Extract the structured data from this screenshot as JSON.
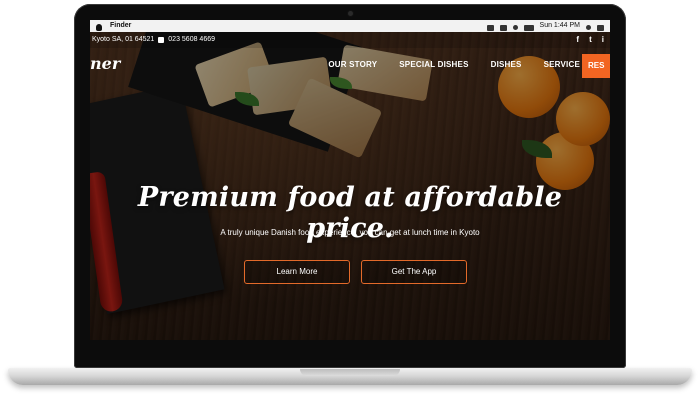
{
  "menubar": {
    "app": "Finder",
    "clock": "Sun 1:44 PM"
  },
  "site": {
    "topbar": {
      "location": "Kyoto SA, 01 64521",
      "phone": "023 5608 4669",
      "social": [
        "f",
        "t",
        "i"
      ]
    },
    "logo": "ner",
    "nav": [
      "OUR STORY",
      "SPECIAL DISHES",
      "DISHES",
      "SERVICE"
    ],
    "cta": "RES",
    "hero": {
      "headline": "Premium food at affordable price.",
      "subheadline": "A truly unique Danish food experience, you can get at lunch time in Kyoto",
      "primary_button": "Learn More",
      "secondary_button": "Get The App"
    }
  },
  "colors": {
    "accent": "#f26522",
    "button_border": "#e36a2a"
  },
  "icons": {
    "menubar": [
      "apple-icon",
      "bluetooth-icon",
      "speaker-icon",
      "wifi-icon",
      "battery-icon",
      "search-icon",
      "menu-icon"
    ],
    "social": [
      "facebook-icon",
      "twitter-icon",
      "instagram-icon"
    ],
    "contact": "phone-icon"
  }
}
